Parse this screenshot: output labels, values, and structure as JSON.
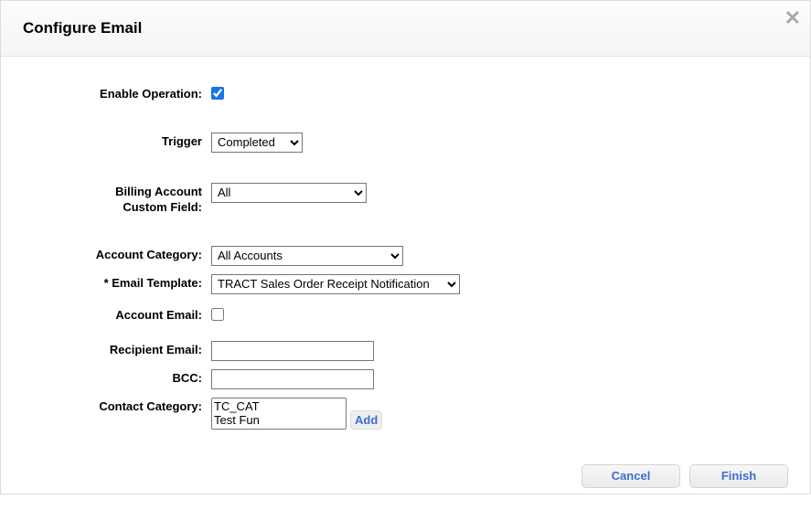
{
  "header": {
    "title": "Configure Email"
  },
  "form": {
    "enable_operation": {
      "label": "Enable Operation:",
      "checked": true
    },
    "trigger": {
      "label": "Trigger",
      "selected": "Completed"
    },
    "billing_account_custom_field": {
      "label": "Billing Account Custom Field:",
      "selected": "All"
    },
    "account_category": {
      "label": "Account Category:",
      "selected": "All Accounts"
    },
    "email_template": {
      "label": "* Email Template:",
      "selected": "TRACT Sales Order Receipt Notification"
    },
    "account_email": {
      "label": "Account Email:",
      "checked": false
    },
    "recipient_email": {
      "label": "Recipient Email:",
      "value": ""
    },
    "bcc": {
      "label": "BCC:",
      "value": ""
    },
    "contact_category": {
      "label": "Contact Category:",
      "options": [
        "TC_CAT",
        "Test Fun"
      ],
      "add_label": "Add"
    }
  },
  "footer": {
    "cancel": "Cancel",
    "finish": "Finish"
  }
}
